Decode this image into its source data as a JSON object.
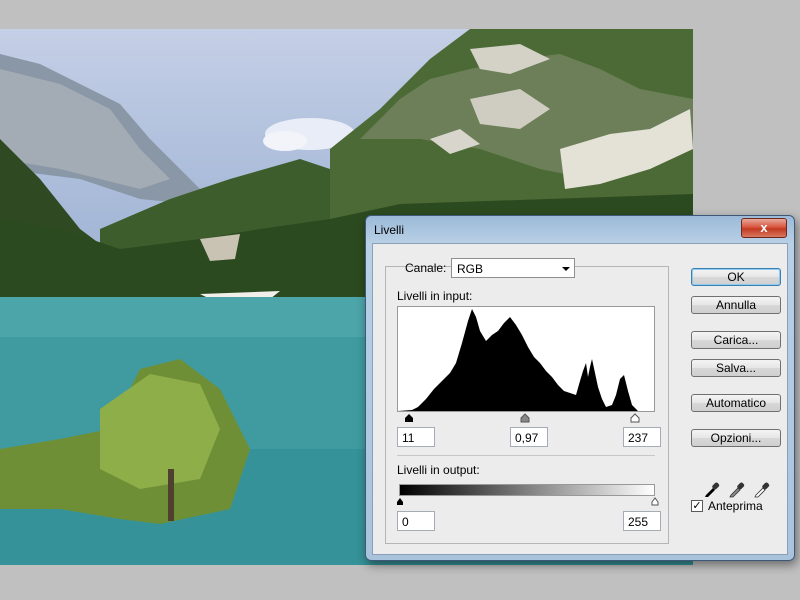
{
  "dialog": {
    "title": "Livelli",
    "close_glyph": "x",
    "channel_label": "Canale:",
    "channel_value": "RGB",
    "input_levels_label": "Livelli in input:",
    "input_black": "11",
    "input_gamma": "0,97",
    "input_white": "237",
    "output_levels_label": "Livelli in output:",
    "output_black": "0",
    "output_white": "255",
    "buttons": {
      "ok": "OK",
      "cancel": "Annulla",
      "load": "Carica...",
      "save": "Salva...",
      "auto": "Automatico",
      "options": "Opzioni..."
    },
    "preview_label": "Anteprima",
    "preview_checked": true
  },
  "icons": [
    "close-icon",
    "dropdown-arrow-icon",
    "black-eyedropper-icon",
    "gray-eyedropper-icon",
    "white-eyedropper-icon",
    "checkmark-icon"
  ]
}
